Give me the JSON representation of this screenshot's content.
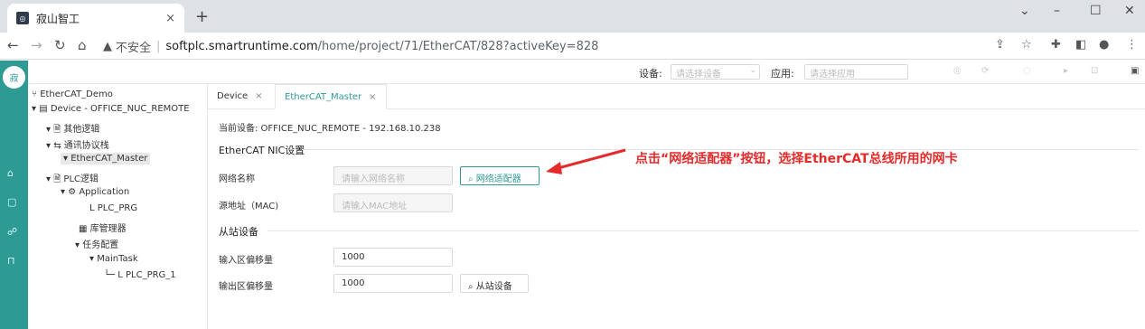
{
  "browser": {
    "tab_title": "寂山智工",
    "tab_close": "×",
    "new_tab": "+",
    "security_label": "不安全",
    "url_host": "softplc.smartruntime.com",
    "url_path": "/home/project/71/EtherCAT/828?activeKey=828"
  },
  "toolbar": {
    "device_label": "设备:",
    "device_placeholder": "请选择设备",
    "app_label": "应用:",
    "app_placeholder": "请选择应用"
  },
  "tree": {
    "project": "EtherCAT_Demo",
    "device": "Device - OFFICE_NUC_REMOTE",
    "other_logic": "其他逻辑",
    "comm_bus": "通讯协议栈",
    "ethercat_master": "EtherCAT_Master",
    "plc_logic": "PLC逻辑",
    "application": "Application",
    "plc_prg": "PLC_PRG",
    "library_manager": "库管理器",
    "task_config": "任务配置",
    "main_task": "MainTask",
    "plc_prg_1": "PLC_PRG_1"
  },
  "tabs": [
    {
      "label": "Device"
    },
    {
      "label": "EtherCAT_Master"
    }
  ],
  "form": {
    "current_device": "当前设备: OFFICE_NUC_REMOTE - 192.168.10.238",
    "nic_section": "EtherCAT NIC设置",
    "net_name_label": "网络名称",
    "net_name_placeholder": "请输入网络名称",
    "net_adapter_button": "网络适配器",
    "mac_label": "源地址（MAC)",
    "mac_placeholder": "请输入MAC地址",
    "slave_section": "从站设备",
    "input_offset_label": "输入区偏移量",
    "input_offset_value": "1000",
    "output_offset_label": "输出区偏移量",
    "output_offset_value": "1000",
    "slave_button": "从站设备"
  },
  "annotation": "点击“网络适配器”按钮，选择EtherCAT总线所用的网卡",
  "colors": {
    "accent": "#2d9a93",
    "annotation": "#e52a2a"
  }
}
